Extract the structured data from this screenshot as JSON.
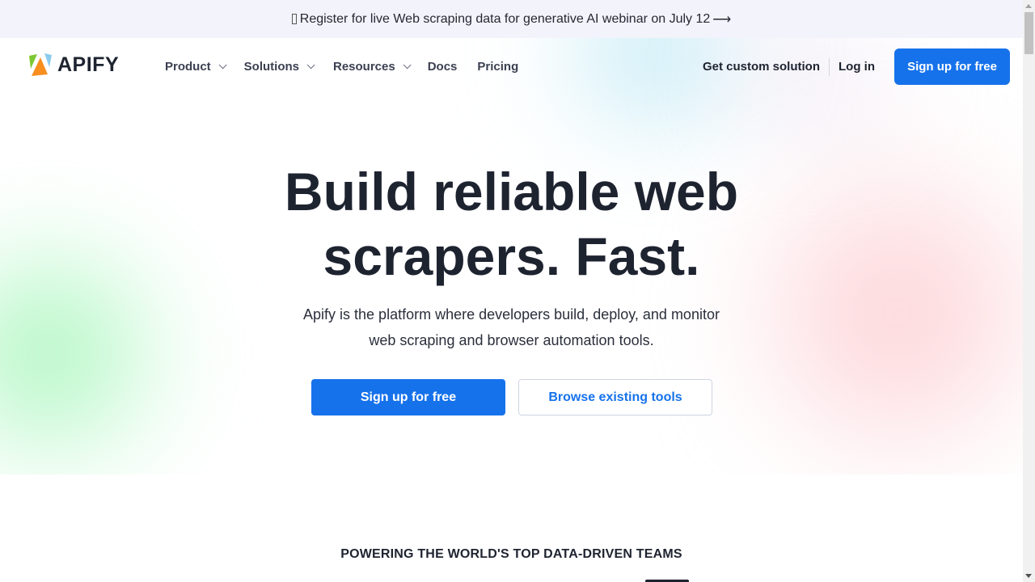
{
  "banner": {
    "glyph": "",
    "text": "Register for live Web scraping data for generative AI webinar on July 12",
    "arrow": "⟶"
  },
  "nav": {
    "logo_text": "APIFY",
    "logo_colors": {
      "green": "#7dc832",
      "orange": "#f78e1e",
      "blue": "#8ccbee"
    },
    "items": [
      {
        "label": "Product",
        "has_dropdown": true
      },
      {
        "label": "Solutions",
        "has_dropdown": true
      },
      {
        "label": "Resources",
        "has_dropdown": true
      },
      {
        "label": "Docs",
        "has_dropdown": false
      },
      {
        "label": "Pricing",
        "has_dropdown": false
      }
    ],
    "custom_solution": "Get custom solution",
    "login": "Log in",
    "signup": "Sign up for free"
  },
  "hero": {
    "headline_line1": "Build reliable web",
    "headline_line2": "scrapers. Fast.",
    "subtitle_line1": "Apify is the platform where developers build, deploy, and monitor",
    "subtitle_line2": "web scraping and browser automation tools.",
    "primary_cta": "Sign up for free",
    "secondary_cta": "Browse existing tools"
  },
  "customers": {
    "heading": "POWERING THE WORLD'S TOP DATA-DRIVEN TEAMS"
  },
  "colors": {
    "accent": "#1672eb",
    "text": "#1e2330",
    "banner_bg": "#f3f4fb"
  }
}
